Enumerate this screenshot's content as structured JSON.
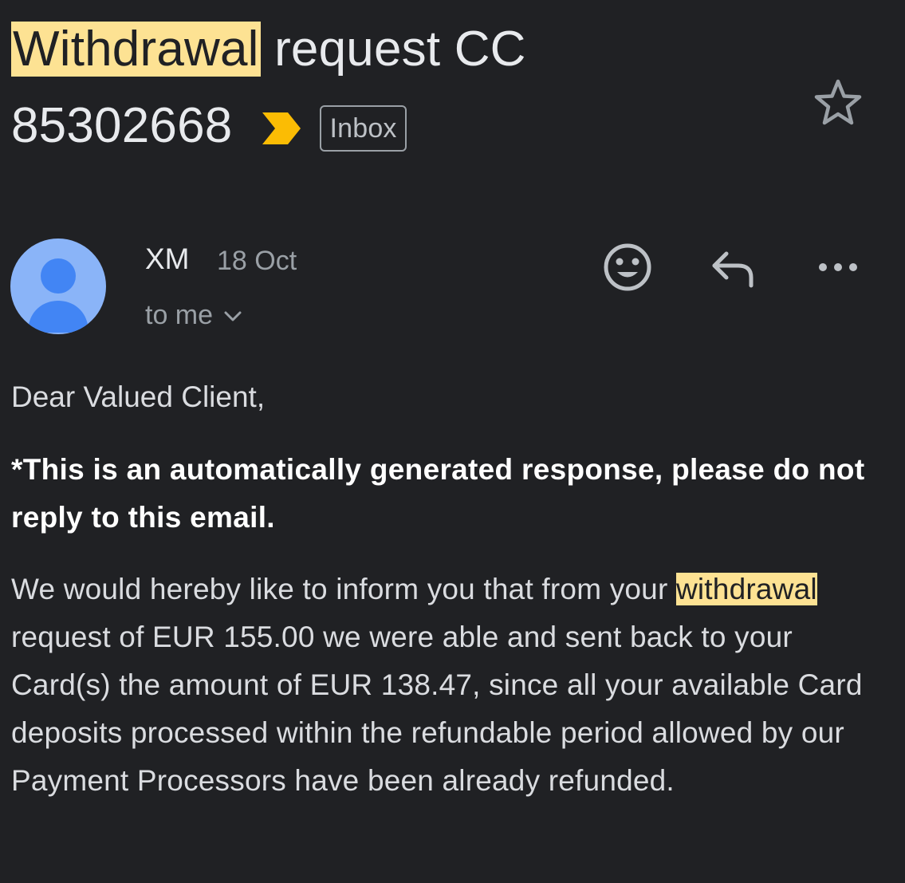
{
  "subject": {
    "highlight": "Withdrawal",
    "rest_line1": " request CC",
    "line2": "85302668",
    "label_chip": "Inbox"
  },
  "sender": {
    "name": "XM",
    "date": "18 Oct",
    "recipient": "to me"
  },
  "body": {
    "greeting": "Dear Valued Client,",
    "notice": "*This is an automatically generated response, please do not reply to this email.",
    "para_before": "We would hereby like to inform you that from your ",
    "para_highlight": "withdrawal",
    "para_after": " request of EUR 155.00 we were able and sent back to your Card(s) the amount of EUR 138.47, since all your available Card deposits processed within the refundable period allowed by our Payment Processors have been already refunded."
  },
  "colors": {
    "background": "#202124",
    "highlight": "#fde293",
    "importance_marker": "#fbbc04",
    "avatar_bg": "#8ab4f8",
    "avatar_fg": "#4285f4"
  },
  "icons": {
    "importance": "importance-marker-icon",
    "star": "star-icon",
    "emoji": "add-reaction-icon",
    "reply": "reply-icon",
    "more": "more-options-icon",
    "recipient_expand": "chevron-down-icon"
  }
}
